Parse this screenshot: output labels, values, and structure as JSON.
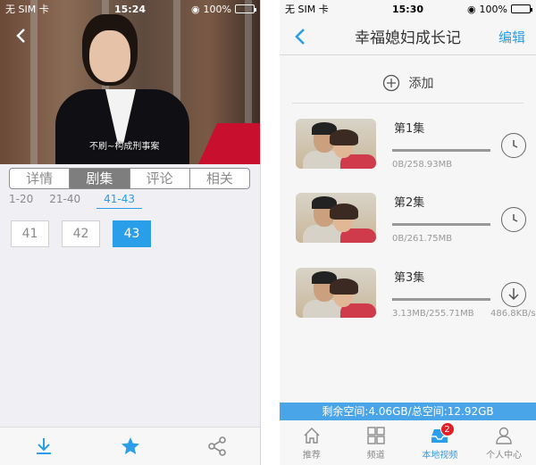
{
  "left": {
    "status": {
      "carrier": "无 SIM 卡",
      "time": "15:24",
      "battery": "100%"
    },
    "video": {
      "subtitle": "不刷~构成刑事案"
    },
    "tabs": [
      {
        "label": "详情"
      },
      {
        "label": "剧集"
      },
      {
        "label": "评论"
      },
      {
        "label": "相关"
      }
    ],
    "ranges": [
      "1-20",
      "21-40",
      "41-43"
    ],
    "episodes": [
      "41",
      "42",
      "43"
    ],
    "active_episode": "43"
  },
  "right": {
    "status": {
      "carrier": "无 SIM 卡",
      "time": "15:30",
      "battery": "100%"
    },
    "nav": {
      "title": "幸福媳妇成长记",
      "edit": "编辑"
    },
    "add_label": "添加",
    "downloads": [
      {
        "title": "第1集",
        "size": "0B/258.93MB",
        "progress": 0,
        "speed": "",
        "state": "waiting"
      },
      {
        "title": "第2集",
        "size": "0B/261.75MB",
        "progress": 0,
        "speed": "",
        "state": "waiting"
      },
      {
        "title": "第3集",
        "size": "3.13MB/255.71MB",
        "progress": 0.012,
        "speed": "486.8KB/s",
        "state": "downloading"
      }
    ],
    "storage": "剩余空间:4.06GB/总空间:12.92GB",
    "tabbar": [
      {
        "label": "推荐",
        "icon": "home-icon"
      },
      {
        "label": "频道",
        "icon": "grid-icon"
      },
      {
        "label": "本地视频",
        "icon": "inbox-icon",
        "badge": "2",
        "active": true
      },
      {
        "label": "个人中心",
        "icon": "person-icon"
      }
    ]
  },
  "colors": {
    "accent": "#2a9ee8",
    "badge": "#e31e24",
    "storage_bar": "#4aa5e8"
  }
}
